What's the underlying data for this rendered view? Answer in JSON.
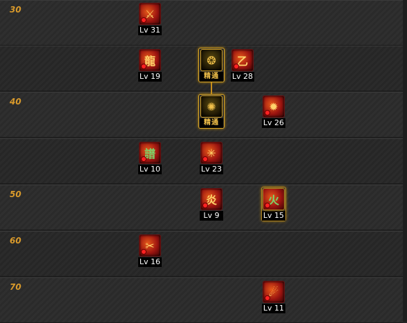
{
  "rows": [
    {
      "label": "30"
    },
    {
      "label": ""
    },
    {
      "label": "40"
    },
    {
      "label": ""
    },
    {
      "label": "50"
    },
    {
      "label": "60"
    },
    {
      "label": "70"
    }
  ],
  "skills": [
    {
      "name": "skill-sword-slash",
      "caption": "Lv 31",
      "glyph": "⚔"
    },
    {
      "name": "skill-dragon-strike",
      "caption": "Lv 19",
      "glyph": "龍"
    },
    {
      "name": "skill-mastery-1",
      "caption": "精通",
      "glyph": "❂"
    },
    {
      "name": "skill-dragon-coil",
      "caption": "Lv 28",
      "glyph": "乙"
    },
    {
      "name": "skill-mastery-2",
      "caption": "精通",
      "glyph": "✺"
    },
    {
      "name": "skill-phoenix",
      "caption": "Lv 26",
      "glyph": "✹"
    },
    {
      "name": "skill-seal",
      "caption": "Lv 10",
      "glyph": "譜"
    },
    {
      "name": "skill-explosion",
      "caption": "Lv 23",
      "glyph": "✳"
    },
    {
      "name": "skill-fire-wave",
      "caption": "Lv 9",
      "glyph": "炎"
    },
    {
      "name": "skill-fire-circle",
      "caption": "Lv 15",
      "glyph": "火"
    },
    {
      "name": "skill-twin-blade",
      "caption": "Lv 16",
      "glyph": "✂"
    },
    {
      "name": "skill-flame-slash",
      "caption": "Lv 11",
      "glyph": "☄"
    }
  ]
}
